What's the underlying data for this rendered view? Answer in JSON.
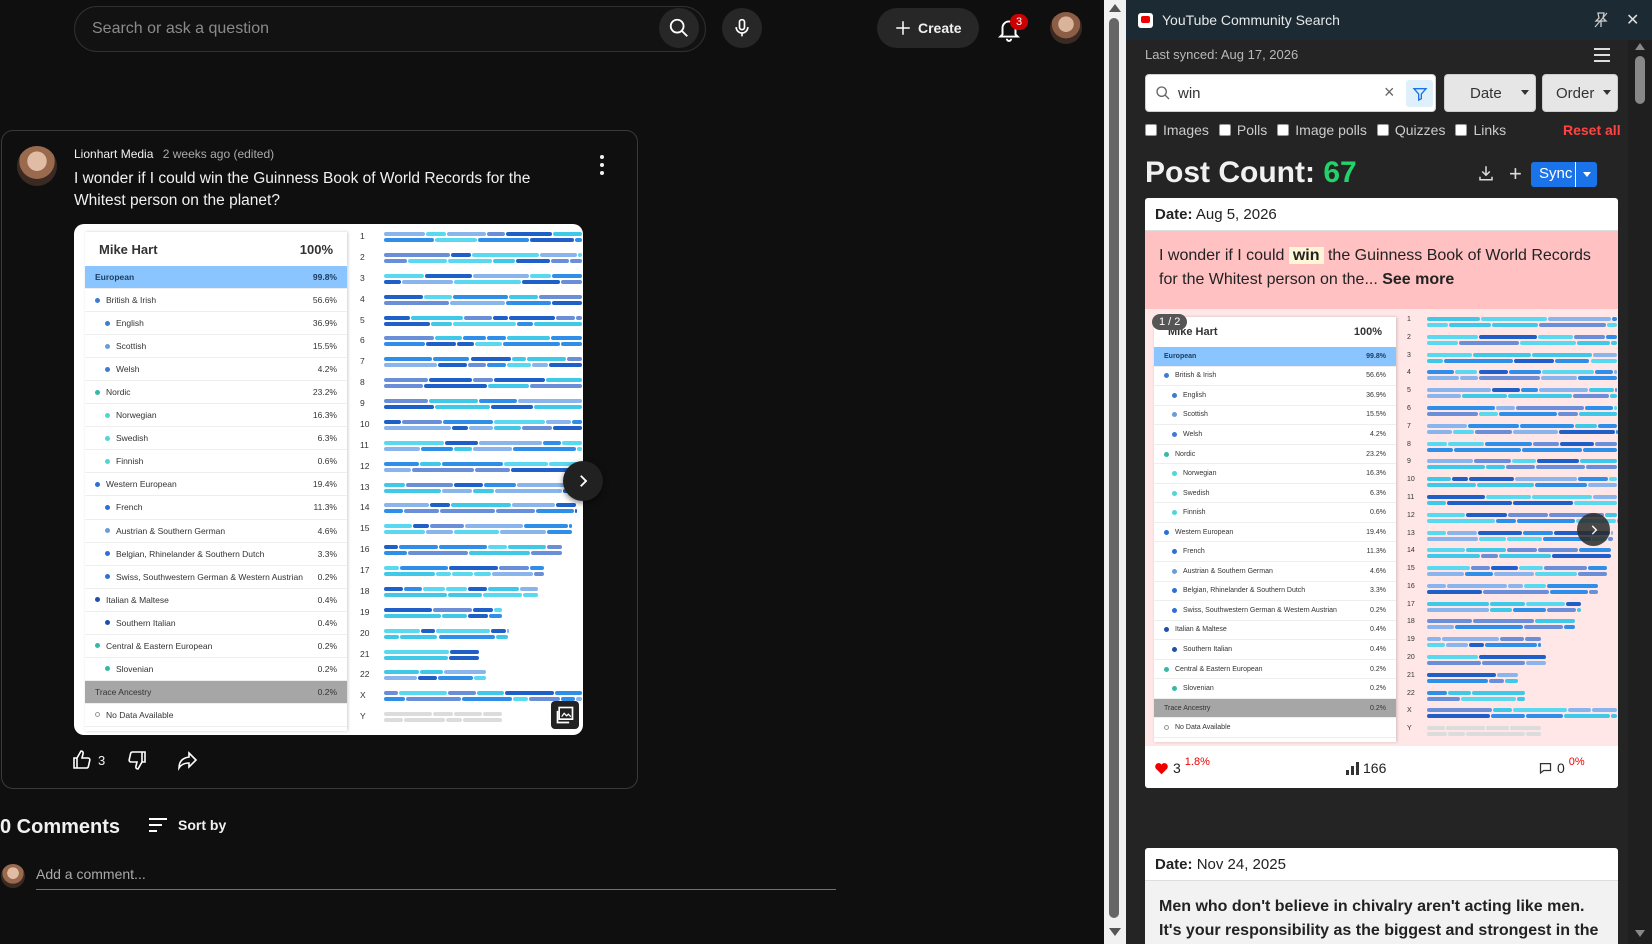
{
  "youtube": {
    "search_placeholder": "Search or ask a question",
    "create_label": "Create",
    "notifications_count": "3",
    "post": {
      "author": "Lionhart Media",
      "time": "2 weeks ago (edited)",
      "text": "I wonder if I could win the Guinness Book of World Records for the Whitest person on the planet?",
      "likes": "3"
    },
    "comments_title": "0 Comments",
    "sort_label": "Sort by",
    "add_comment_placeholder": "Add a comment..."
  },
  "ancestry": {
    "name": "Mike Hart",
    "total": "100%",
    "rows": [
      {
        "label": "European",
        "pct": "99.8%",
        "level": 0,
        "dot": ""
      },
      {
        "label": "British & Irish",
        "pct": "56.6%",
        "level": 1,
        "dot": "#3f7bd1"
      },
      {
        "label": "English",
        "pct": "36.9%",
        "level": 2,
        "dot": "#3f7bd1"
      },
      {
        "label": "Scottish",
        "pct": "15.5%",
        "level": 2,
        "dot": "#6b9bd8"
      },
      {
        "label": "Welsh",
        "pct": "4.2%",
        "level": 2,
        "dot": "#3f7bd1"
      },
      {
        "label": "Nordic",
        "pct": "23.2%",
        "level": 1,
        "dot": "#35b8a8"
      },
      {
        "label": "Norwegian",
        "pct": "16.3%",
        "level": 2,
        "dot": "#4fd6d6"
      },
      {
        "label": "Swedish",
        "pct": "6.3%",
        "level": 2,
        "dot": "#4fd6d6"
      },
      {
        "label": "Finnish",
        "pct": "0.6%",
        "level": 2,
        "dot": "#4fd6d6"
      },
      {
        "label": "Western European",
        "pct": "19.4%",
        "level": 1,
        "dot": "#2d6fd6"
      },
      {
        "label": "French",
        "pct": "11.3%",
        "level": 2,
        "dot": "#2d6fd6"
      },
      {
        "label": "Austrian & Southern German",
        "pct": "4.6%",
        "level": 2,
        "dot": "#6b9bd8"
      },
      {
        "label": "Belgian, Rhinelander & Southern Dutch",
        "pct": "3.3%",
        "level": 2,
        "dot": "#2d6fd6"
      },
      {
        "label": "Swiss, Southwestern German & Western Austrian",
        "pct": "0.2%",
        "level": 2,
        "dot": "#2d6fd6"
      },
      {
        "label": "Italian & Maltese",
        "pct": "0.4%",
        "level": 1,
        "dot": "#1f4fa8"
      },
      {
        "label": "Southern Italian",
        "pct": "0.4%",
        "level": 2,
        "dot": "#1f4fa8"
      },
      {
        "label": "Central & Eastern European",
        "pct": "0.2%",
        "level": 1,
        "dot": "#35b8a8"
      },
      {
        "label": "Slovenian",
        "pct": "0.2%",
        "level": 2,
        "dot": "#35b8a8"
      },
      {
        "label": "Trace Ancestry",
        "pct": "0.2%",
        "level": 0,
        "dot": "",
        "trace": true
      },
      {
        "label": "No Data Available",
        "pct": "",
        "level": 1,
        "dot": "hollow"
      }
    ],
    "chromosomes": [
      "1",
      "2",
      "3",
      "4",
      "5",
      "6",
      "7",
      "8",
      "9",
      "10",
      "11",
      "12",
      "13",
      "14",
      "15",
      "16",
      "17",
      "18",
      "19",
      "20",
      "21",
      "22",
      "X",
      "Y"
    ]
  },
  "extension": {
    "title": "YouTube Community Search",
    "last_synced": "Last synced: Aug 17, 2026",
    "search_value": "win",
    "date_label": "Date",
    "order_label": "Order",
    "filters": [
      "Images",
      "Polls",
      "Image polls",
      "Quizzes",
      "Links"
    ],
    "reset_label": "Reset all",
    "post_count_label": "Post Count:",
    "post_count": "67",
    "sync_label": "Sync",
    "results": [
      {
        "date_label": "Date:",
        "date": "Aug 5, 2026",
        "text_before": "I wonder if I could",
        "highlight": "win",
        "text_after": "the Guinness Book of World Records for the Whitest person on the...",
        "see_more": "See more",
        "image_counter": "1 / 2",
        "likes": "3",
        "likes_pct": "1.8%",
        "views": "166",
        "comments": "0",
        "comments_pct": "0%"
      },
      {
        "date_label": "Date:",
        "date": "Nov 24, 2025",
        "text": "Men who don't believe in chivalry aren't acting like men. It's your responsibility as the biggest and strongest in the family"
      }
    ]
  },
  "colors": {
    "youtube_bg": "#0f0f0f",
    "post_count_green": "#22d36a",
    "sync_blue": "#1a73e8",
    "reset_red": "#ff4444",
    "highlight_pink": "#ffc1c1"
  }
}
